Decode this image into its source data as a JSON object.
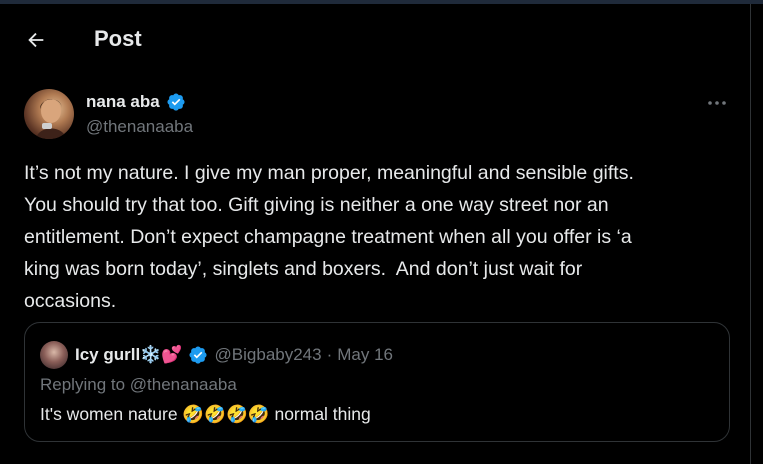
{
  "header": {
    "title": "Post"
  },
  "post": {
    "author_name": "nana aba",
    "author_handle": "@thenanaaba",
    "text": "It’s not my nature. I give my man proper, meaningful and sensible gifts.\nYou should try that too. Gift giving is neither a one way street nor an\nentitlement. Don’t expect champagne treatment when all you offer is ‘a\nking was born today’, singlets and boxers.  And don’t just wait for\noccasions."
  },
  "quote": {
    "author_name": "Icy gurll❄️💕",
    "author_handle": "@Bigbaby243",
    "separator": "·",
    "date": "May 16",
    "replying_to": "Replying to @thenanaaba",
    "text": "It's women nature 🤣🤣🤣🤣 normal thing"
  },
  "colors": {
    "background": "#000000",
    "text_primary": "#e7e9ea",
    "text_secondary": "#71767b",
    "border": "#2f3336",
    "verified_blue": "#1d9bf0"
  },
  "icons": {
    "back": "arrow-left-icon",
    "verified": "verified-badge-icon",
    "more": "more-horizontal-icon"
  }
}
